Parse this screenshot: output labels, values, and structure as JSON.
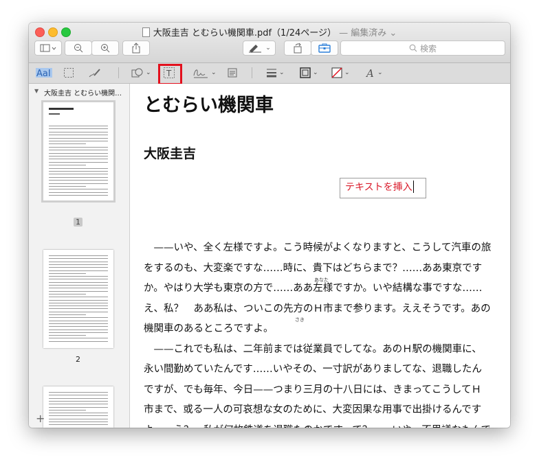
{
  "window": {
    "title": "大阪圭吉 とむらい機関車.pdf（1/24ページ）",
    "status": "— 編集済み ⌄"
  },
  "toolbar": {
    "search_placeholder": "検索",
    "search_icon": "magnifier-icon"
  },
  "markup": {
    "selected_tool": "text-box-tool",
    "highlight_color": "#e3101d"
  },
  "sidebar": {
    "doc_name": "大阪圭吉 とむらい機関…",
    "pages": [
      {
        "label": "1",
        "selected": true
      },
      {
        "label": "2",
        "selected": false
      }
    ]
  },
  "document": {
    "title": "とむらい機関車",
    "author": "大阪圭吉",
    "inserted_text": "テキストを挿入",
    "ruby_1": "あなた",
    "ruby_2": "さき",
    "ruby_3": "やめ",
    "lines": [
      "　——いや、全く左様ですよ。こう時候がよくなりますと、こうして汽車の旅",
      "をするのも、大変楽ですな……時に、貴下はどちらまで？……ああ東京です",
      "か。やはり大学も東京の方で……ああ左様ですか。いや結構な事ですな……",
      "え、私？　ああ私は、ついこの先方のＨ市まで参ります。ええそうです。あの",
      "機関車のあるところですよ。",
      "　——これでも私は、二年前までは従業員でしてな。あのＨ駅の機関車に、",
      "永い間勤めていたんです……いやその、一寸訳がありましてな、退職したん",
      "ですが、でも毎年、今日——つまり三月の十八日には、きまってこうしてＨ",
      "市まで、或る一人の可哀想な女のために、大変因果な用事で出掛けるんです",
      "よ……え？　私が何故鉄道を退職たのかですって？……いや、不思議なもんで"
    ]
  }
}
